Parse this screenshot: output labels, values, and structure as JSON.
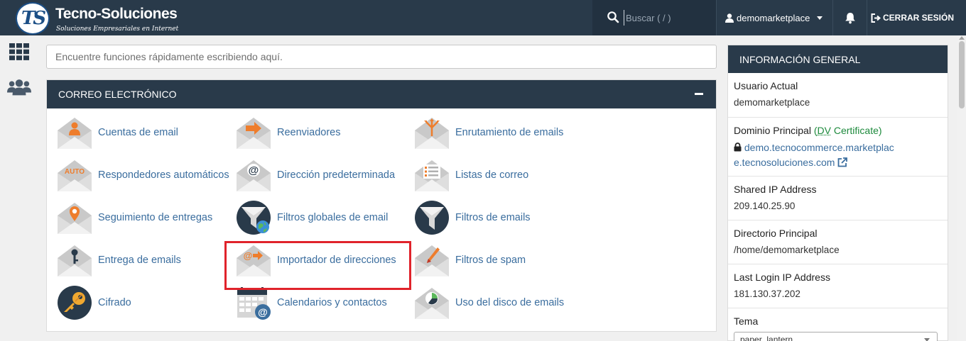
{
  "header": {
    "logo_mark": "TS",
    "brand_title": "Tecno-Soluciones",
    "brand_subtitle": "Soluciones Empresariales en Internet",
    "search_placeholder": "Buscar ( / )",
    "username": "demomarketplace",
    "logout_label": "CERRAR SESIÓN"
  },
  "sidebar": {
    "items": [
      {
        "name": "apps-grid-icon"
      },
      {
        "name": "users-icon"
      }
    ]
  },
  "quick_search": {
    "placeholder": "Encuentre funciones rápidamente escribiendo aquí."
  },
  "email_section": {
    "title": "CORREO ELECTRÓNICO",
    "tools": [
      {
        "label": "Cuentas de email",
        "icon": "email-accounts-icon"
      },
      {
        "label": "Reenviadores",
        "icon": "forwarders-icon"
      },
      {
        "label": "Enrutamiento de emails",
        "icon": "email-routing-icon"
      },
      {
        "label": "Respondedores automáticos",
        "icon": "autoresponders-icon"
      },
      {
        "label": "Dirección predeterminada",
        "icon": "default-address-icon"
      },
      {
        "label": "Listas de correo",
        "icon": "mailing-lists-icon"
      },
      {
        "label": "Seguimiento de entregas",
        "icon": "track-delivery-icon"
      },
      {
        "label": "Filtros globales de email",
        "icon": "global-filters-icon"
      },
      {
        "label": "Filtros de emails",
        "icon": "email-filters-icon"
      },
      {
        "label": "Entrega de emails",
        "icon": "email-deliverability-icon"
      },
      {
        "label": "Importador de direcciones",
        "icon": "address-importer-icon"
      },
      {
        "label": "Filtros de spam",
        "icon": "spam-filters-icon"
      },
      {
        "label": "Cifrado",
        "icon": "encryption-icon"
      },
      {
        "label": "Calendarios y contactos",
        "icon": "calendars-contacts-icon"
      },
      {
        "label": "Uso del disco de emails",
        "icon": "email-disk-usage-icon"
      }
    ],
    "auto_badge": "AUTO",
    "highlighted_tool": "Importador de direcciones"
  },
  "general_info": {
    "title": "INFORMACIÓN GENERAL",
    "current_user_label": "Usuario Actual",
    "current_user_value": "demomarketplace",
    "primary_domain_label": "Dominio Principal",
    "dv_open": "(",
    "dv_abbr": "DV",
    "dv_rest": " Certificate)",
    "primary_domain_line1": "demo.tecnocommerce.marketplac",
    "primary_domain_line2": "e.tecnosoluciones.com",
    "shared_ip_label": "Shared IP Address",
    "shared_ip_value": "209.140.25.90",
    "home_dir_label": "Directorio Principal",
    "home_dir_value": "/home/demomarketplace",
    "last_login_label": "Last Login IP Address",
    "last_login_value": "181.130.37.202",
    "theme_label": "Tema",
    "theme_value": "paper_lantern"
  },
  "colors": {
    "header_bg": "#293a4a",
    "link": "#3a6d9e",
    "highlight_border": "#e0232b",
    "dv_green": "#1d8a3c"
  }
}
